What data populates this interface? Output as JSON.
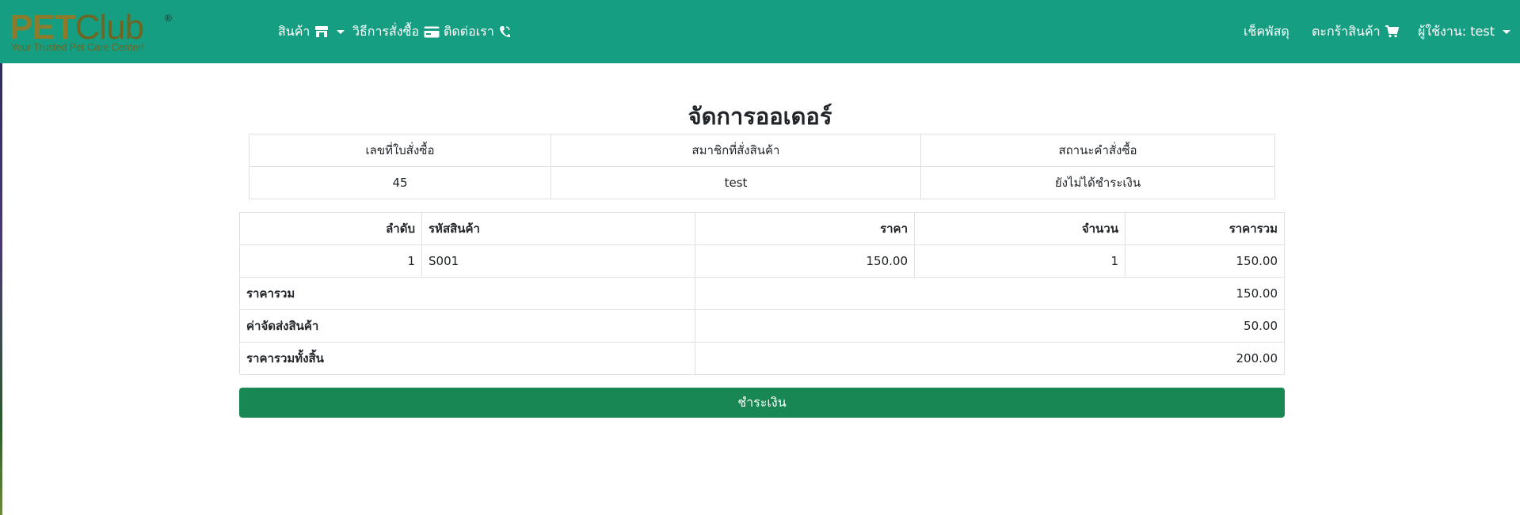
{
  "brand": {
    "logo_pet": "PET",
    "logo_club": "Club",
    "logo_reg": "®",
    "tagline": "Your Trusted Pet Care Center!",
    "colors": {
      "navbar": "#159e82",
      "logo": "#8a7c2c",
      "pay_button": "#198754"
    }
  },
  "nav": {
    "products": {
      "label": "สินค้า",
      "icon": "store-icon"
    },
    "how_to_order": {
      "label": "วิธีการสั่งซื้อ",
      "icon": "credit-card-icon"
    },
    "contact": {
      "label": "ติดต่อเรา",
      "icon": "phone-icon"
    },
    "track": {
      "label": "เช็คพัสดุ"
    },
    "cart": {
      "label": "ตะกร้าสินค้า",
      "icon": "cart-icon"
    },
    "user": {
      "label": "ผู้ใช้งาน: test"
    }
  },
  "page": {
    "title": "จัดการออเดอร์"
  },
  "order": {
    "headers": [
      "เลขที่ใบสั่งซื้อ",
      "สมาชิกที่สั่งสินค้า",
      "สถานะคำสั่งซื้อ"
    ],
    "values": [
      "45",
      "test",
      "ยังไม่ได้ชำระเงิน"
    ]
  },
  "items": {
    "headers": {
      "index": "ลำดับ",
      "code": "รหัสสินค้า",
      "price": "ราคา",
      "qty": "จำนวน",
      "total": "ราคารวม"
    },
    "rows": [
      {
        "index": "1",
        "code": "S001",
        "price": "150.00",
        "qty": "1",
        "total": "150.00"
      }
    ],
    "summary": {
      "subtotal_label": "ราคารวม",
      "subtotal": "150.00",
      "shipping_label": "ค่าจัดส่งสินค้า",
      "shipping": "50.00",
      "grand_label": "ราคารวมทั้งสิ้น",
      "grand": "200.00"
    }
  },
  "actions": {
    "pay_label": "ชำระเงิน"
  }
}
